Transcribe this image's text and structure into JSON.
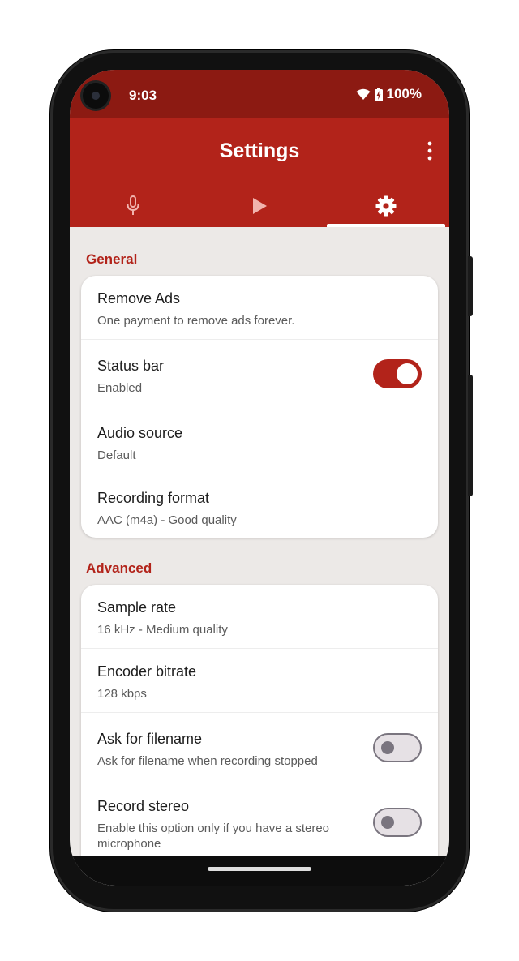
{
  "status_bar": {
    "time": "9:03",
    "battery": "100%",
    "icons": [
      "wifi-icon",
      "battery-charging-icon"
    ]
  },
  "app_bar": {
    "title": "Settings",
    "menu_icon": "more-vert-icon"
  },
  "tabs": [
    {
      "icon": "microphone-icon",
      "active": false
    },
    {
      "icon": "play-icon",
      "active": false
    },
    {
      "icon": "gear-icon",
      "active": true
    }
  ],
  "sections": [
    {
      "title": "General",
      "items": [
        {
          "title": "Remove Ads",
          "subtitle": "One payment to remove ads forever."
        },
        {
          "title": "Status bar",
          "subtitle": "Enabled",
          "toggle": true
        },
        {
          "title": "Audio source",
          "subtitle": "Default"
        },
        {
          "title": "Recording format",
          "subtitle": "AAC (m4a) - Good quality"
        }
      ]
    },
    {
      "title": "Advanced",
      "items": [
        {
          "title": "Sample rate",
          "subtitle": "16 kHz - Medium quality"
        },
        {
          "title": "Encoder bitrate",
          "subtitle": "128 kbps"
        },
        {
          "title": "Ask for filename",
          "subtitle": "Ask for filename when recording stopped",
          "toggle": false
        },
        {
          "title": "Record stereo",
          "subtitle": "Enable this option only if you have a stereo microphone",
          "toggle": false
        }
      ]
    }
  ],
  "colors": {
    "status_bar": "#8c1a12",
    "primary": "#b2231a",
    "background": "#ece9e7",
    "card": "#ffffff"
  }
}
